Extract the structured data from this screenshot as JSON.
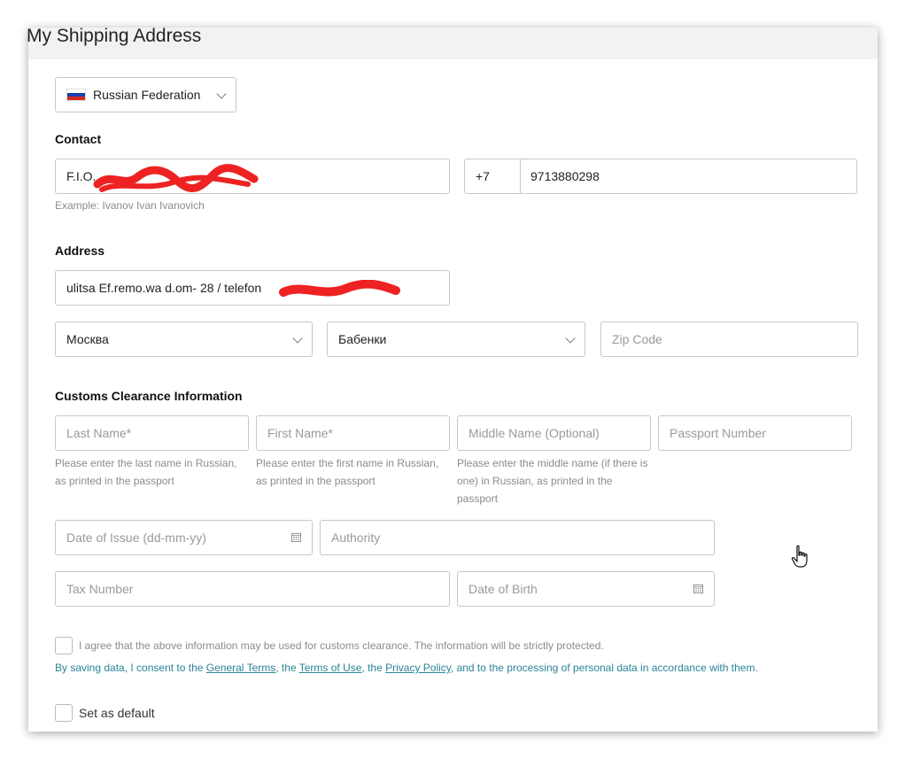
{
  "page": {
    "title": "My Shipping Address"
  },
  "country": {
    "selected": "Russian Federation"
  },
  "contact": {
    "label": "Contact",
    "name_value": "F.I.O.",
    "name_hint": "Example: Ivanov Ivan Ivanovich",
    "phone_code": "+7",
    "phone_number": "9713880298"
  },
  "address": {
    "label": "Address",
    "street_value": "ulitsa  Ef.remo.wa   d.om- 28 / telefon",
    "region": "Москва",
    "city": "Бабенки",
    "zip_placeholder": "Zip Code"
  },
  "customs": {
    "label": "Customs Clearance Information",
    "last_name_placeholder": "Last Name*",
    "first_name_placeholder": "First Name*",
    "middle_name_placeholder": "Middle Name (Optional)",
    "passport_placeholder": "Passport Number",
    "last_name_hint": "Please enter the last name in Russian, as printed in the passport",
    "first_name_hint": "Please enter the first name in Russian, as printed in the passport",
    "middle_name_hint": "Please enter the middle name (if there is one) in Russian, as printed in the passport",
    "date_of_issue_placeholder": "Date of Issue (dd-mm-yy)",
    "authority_placeholder": "Authority",
    "tax_number_placeholder": "Tax Number",
    "date_of_birth_placeholder": "Date of Birth"
  },
  "agreement": {
    "text": "I agree that the above information may be used for customs clearance. The information will be strictly protected.",
    "consent_prefix": "By saving data, I consent to the ",
    "general_terms": "General Terms",
    "sep1": ", the ",
    "terms_of_use": "Terms of Use",
    "sep2": ", the ",
    "privacy_policy": "Privacy Policy",
    "consent_suffix": ", and to the processing of personal data in accordance with them."
  },
  "default": {
    "label": "Set as default"
  },
  "colors": {
    "link": "#2a8496",
    "border": "#c8c8c8",
    "header_bg": "#f2f2f2"
  }
}
